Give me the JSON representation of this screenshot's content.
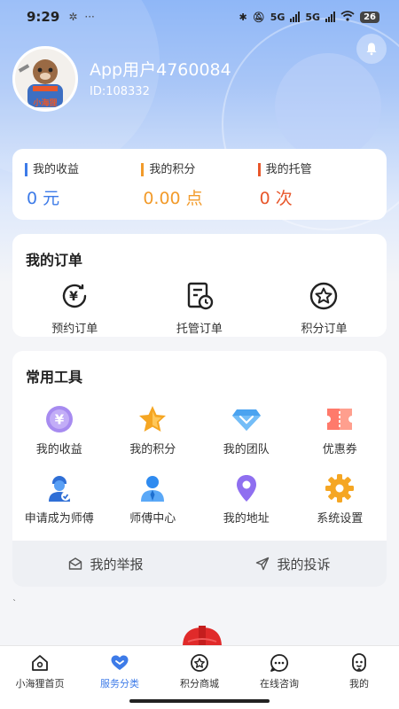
{
  "status_bar": {
    "time": "9:29",
    "left_icons": [
      "notification-icon",
      "more-dots"
    ],
    "more": "···",
    "network_1": "5G",
    "network_2": "5G",
    "battery": "26"
  },
  "profile": {
    "name": "App用户4760084",
    "id_text": "ID:108332",
    "avatar_caption": "小海狸"
  },
  "stats": [
    {
      "label": "我的收益",
      "value": "0 元",
      "color": "#3d7be8"
    },
    {
      "label": "我的积分",
      "value": "0.00 点",
      "color": "#f29b2b"
    },
    {
      "label": "我的托管",
      "value": "0 次",
      "color": "#e8572b"
    }
  ],
  "orders": {
    "title": "我的订单",
    "items": [
      {
        "label": "预约订单",
        "icon": "yuan-clock-icon"
      },
      {
        "label": "托管订单",
        "icon": "document-clock-icon"
      },
      {
        "label": "积分订单",
        "icon": "star-badge-icon"
      }
    ]
  },
  "tools": {
    "title": "常用工具",
    "items": [
      {
        "label": "我的收益",
        "icon": "yuan-coin-icon"
      },
      {
        "label": "我的积分",
        "icon": "star-icon"
      },
      {
        "label": "我的团队",
        "icon": "diamond-icon"
      },
      {
        "label": "优惠券",
        "icon": "coupon-icon"
      },
      {
        "label": "申请成为师傅",
        "icon": "worker-icon"
      },
      {
        "label": "师傅中心",
        "icon": "person-icon"
      },
      {
        "label": "我的地址",
        "icon": "location-pin-icon"
      },
      {
        "label": "系统设置",
        "icon": "gear-icon"
      }
    ],
    "footer": [
      {
        "label": "我的举报",
        "icon": "envelope-icon"
      },
      {
        "label": "我的投诉",
        "icon": "send-icon"
      }
    ]
  },
  "tick_mark": "`",
  "tab_bar": [
    {
      "label": "小海狸首页",
      "icon": "home-icon",
      "active": false
    },
    {
      "label": "服务分类",
      "icon": "heart-icon",
      "active": true
    },
    {
      "label": "积分商城",
      "icon": "star-circle-icon",
      "active": false
    },
    {
      "label": "在线咨询",
      "icon": "chat-icon",
      "active": false
    },
    {
      "label": "我的",
      "icon": "face-icon",
      "active": false
    }
  ],
  "colors": {
    "accent": "#3d7be8",
    "income": "#3d7be8",
    "points": "#f29b2b",
    "trust": "#e8572b"
  }
}
